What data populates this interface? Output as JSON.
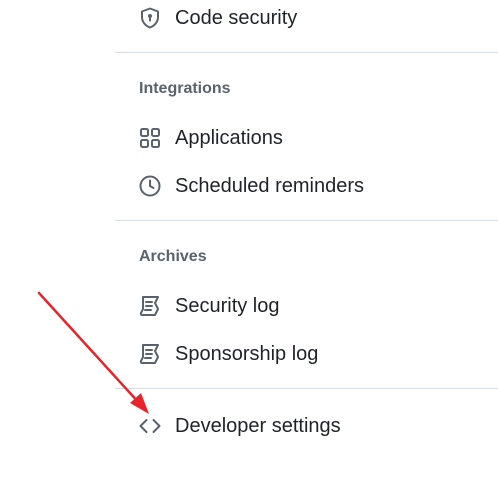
{
  "nav": {
    "code_security": {
      "label": "Code security",
      "icon": "shield-lock-icon"
    },
    "integrations": {
      "heading": "Integrations",
      "items": [
        {
          "label": "Applications",
          "icon": "apps-icon"
        },
        {
          "label": "Scheduled reminders",
          "icon": "clock-icon"
        }
      ]
    },
    "archives": {
      "heading": "Archives",
      "items": [
        {
          "label": "Security log",
          "icon": "log-icon"
        },
        {
          "label": "Sponsorship log",
          "icon": "log-icon"
        }
      ]
    },
    "developer_settings": {
      "label": "Developer settings",
      "icon": "code-icon"
    }
  },
  "colors": {
    "text": "#1f2328",
    "muted": "#59636e",
    "divider": "#d8dee4",
    "annotation_arrow": "#e8242a"
  }
}
